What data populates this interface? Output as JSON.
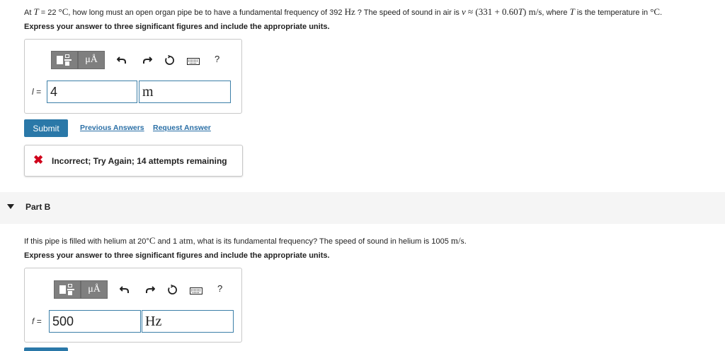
{
  "part_a": {
    "question": {
      "t1": "At ",
      "T": "T",
      "t2": " = 22 ",
      "degC": "°C",
      "t3": ", how long must an open organ pipe be to have a fundamental frequency of 392 ",
      "Hz": "Hz",
      "t4": " ? The speed of sound in air is ",
      "v": "v",
      "approx": " ≈ ",
      "formula": "(331 + 0.60",
      "T2": "T",
      "formula_end": ") m/s",
      "t5": ", where ",
      "T3": "T",
      "t6": " is the temperature in ",
      "degC2": "°C",
      "t7": "."
    },
    "instruction": "Express your answer to three significant figures and include the appropriate units.",
    "toolbar": {
      "mu_label": "μÅ",
      "help_label": "?"
    },
    "var_label": "l =",
    "value": "4",
    "unit": "m",
    "submit_label": "Submit",
    "previous_answers": "Previous Answers",
    "request_answer": "Request Answer",
    "feedback_icon": "✖",
    "feedback": "Incorrect; Try Again; 14 attempts remaining"
  },
  "part_b": {
    "title": "Part B",
    "question": {
      "t1": "If this pipe is filled with helium at 20",
      "deg": "°",
      "C": "C",
      "t2": " and 1 ",
      "atm": "atm",
      "t3": ", what is its fundamental frequency? The speed of sound in helium is 1005 ",
      "ms": "m/s",
      "t4": "."
    },
    "instruction": "Express your answer to three significant figures and include the appropriate units.",
    "toolbar": {
      "mu_label": "μÅ",
      "help_label": "?"
    },
    "var_label": "f =",
    "value": "500",
    "unit": "Hz"
  },
  "colors": {
    "submit": "#2a78a8",
    "link": "#2a6fa6",
    "error": "#d0021b",
    "field_border": "#3c7fa8"
  }
}
